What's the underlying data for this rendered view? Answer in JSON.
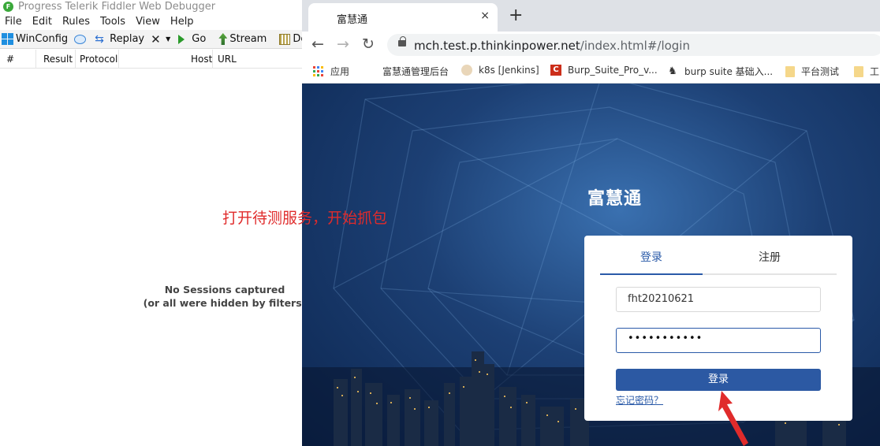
{
  "fiddler": {
    "title": "Progress Telerik Fiddler Web Debugger",
    "menu": [
      "File",
      "Edit",
      "Rules",
      "Tools",
      "View",
      "Help"
    ],
    "toolbar": {
      "winconfig": "WinConfig",
      "replay": "Replay",
      "go": "Go",
      "stream": "Stream",
      "decode": "Decod"
    },
    "columns": {
      "num": "#",
      "result": "Result",
      "protocol": "Protocol",
      "host": "Host",
      "url": "URL"
    },
    "empty_line1": "No Sessions captured",
    "empty_line2": "(or all were hidden by filters)"
  },
  "annotation": {
    "text": "打开待测服务，开始抓包",
    "color": "#e02b2b"
  },
  "browser": {
    "tab_title": "富慧通",
    "close_symbol": "×",
    "new_tab_symbol": "+",
    "url_host": "mch.test.p.thinkinpower.net",
    "url_path": "/index.html#/login",
    "bookmarks": [
      {
        "label": "应用",
        "icon": "apps-icon"
      },
      {
        "label": "富慧通管理后台",
        "icon": "none"
      },
      {
        "label": "k8s [Jenkins]",
        "icon": "jenkins-icon"
      },
      {
        "label": "Burp_Suite_Pro_v...",
        "icon": "burp-icon"
      },
      {
        "label": "burp suite 基础入...",
        "icon": "pc-icon"
      },
      {
        "label": "平台测试",
        "icon": "folder-icon"
      },
      {
        "label": "工",
        "icon": "folder-icon"
      }
    ],
    "page": {
      "brand": "富慧通",
      "tab_login": "登录",
      "tab_register": "注册",
      "username": "fht20210621",
      "password": "•••••••••••",
      "login_button": "登录",
      "forgot": "忘记密码？",
      "accent": "#2c59a3"
    }
  }
}
